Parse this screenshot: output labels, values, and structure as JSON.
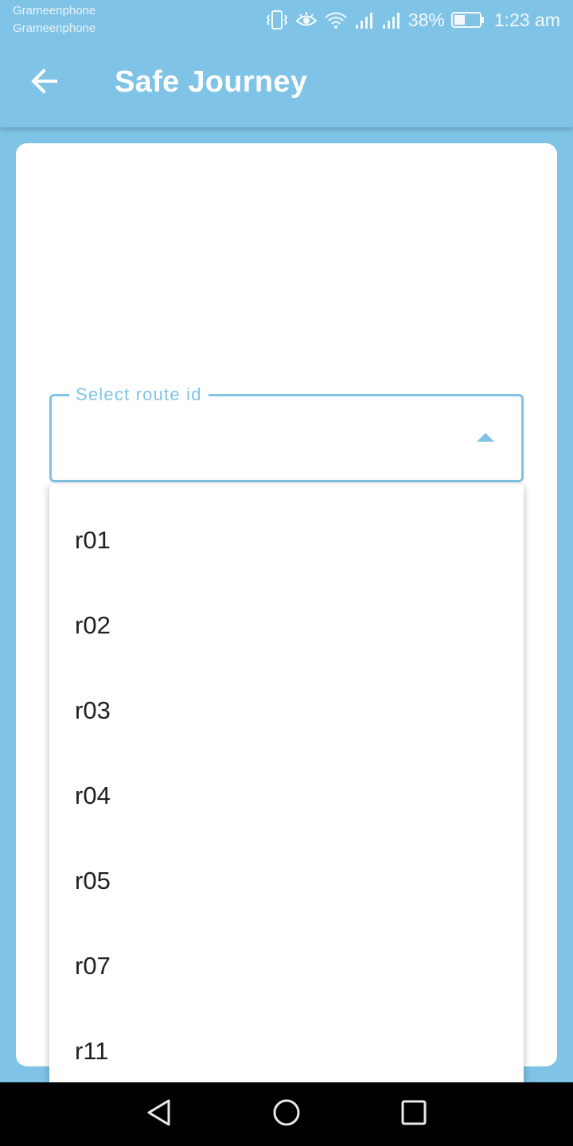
{
  "status_bar": {
    "carrier_1": "Grameenphone",
    "carrier_2": "Grameenphone",
    "battery_percent": "38%",
    "time": "1:23 am",
    "icons": [
      "vibrate-icon",
      "eye-comfort-icon",
      "wifi-icon",
      "signal-icon",
      "signal-icon",
      "battery-icon"
    ]
  },
  "app_bar": {
    "back_icon": "arrow-left-icon",
    "title": "Safe Journey"
  },
  "route_select": {
    "label": "Select route id",
    "selected_value": "",
    "expanded": true,
    "arrow_icon": "triangle-up-icon"
  },
  "dropdown": {
    "options": [
      "r01",
      "r02",
      "r03",
      "r04",
      "r05",
      "r07",
      "r11"
    ]
  },
  "nav_bar": {
    "back_icon": "triangle-back-icon",
    "home_icon": "circle-home-icon",
    "recents_icon": "square-recents-icon"
  },
  "colors": {
    "primary": "#7fc3e6",
    "card": "#ffffff",
    "text": "#202020",
    "nav_bar": "#000000"
  }
}
